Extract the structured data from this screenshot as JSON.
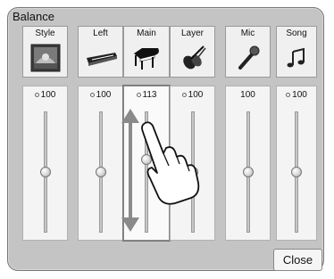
{
  "dialog": {
    "title": "Balance",
    "close_label": "Close"
  },
  "channels": [
    {
      "label": "Style",
      "value": "100",
      "show_dot": true,
      "icon": "style-photo-icon",
      "level": 0.5
    },
    {
      "label": "Left",
      "value": "100",
      "show_dot": true,
      "icon": "keyboard-icon",
      "level": 0.5
    },
    {
      "label": "Main",
      "value": "113",
      "show_dot": true,
      "icon": "grand-piano-icon",
      "level": 0.6,
      "selected": true
    },
    {
      "label": "Layer",
      "value": "100",
      "show_dot": true,
      "icon": "strings-icon",
      "level": 0.5
    },
    {
      "label": "Mic",
      "value": "100",
      "show_dot": false,
      "icon": "microphone-icon",
      "level": 0.5
    },
    {
      "label": "Song",
      "value": "100",
      "show_dot": true,
      "icon": "music-note-icon",
      "level": 0.5
    }
  ],
  "colors": {
    "panel": "#c4c4c4",
    "strip": "#f4f4f4",
    "accent": "#777777"
  }
}
